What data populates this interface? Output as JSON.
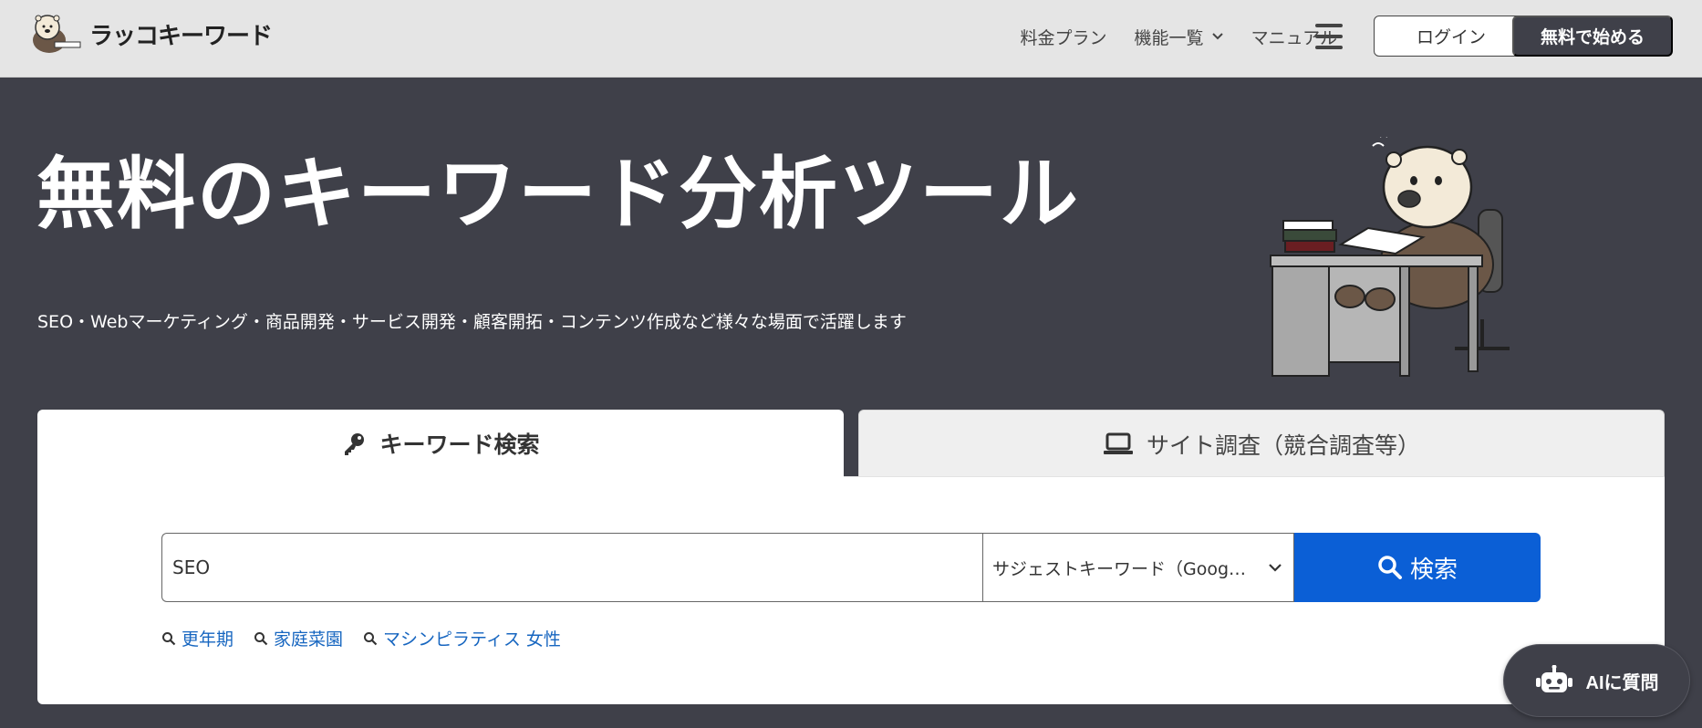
{
  "header": {
    "logo_text": "ラッコキーワード",
    "nav": [
      {
        "label": "料金プラン"
      },
      {
        "label": "機能一覧"
      },
      {
        "label": "マニュアル"
      }
    ],
    "login_label": "ログイン",
    "start_label": "無料で始める"
  },
  "hero": {
    "title": "無料のキーワード分析ツール",
    "subtitle": "SEO・Webマーケティング・商品開発・サービス開発・顧客開拓・コンテンツ作成など様々な場面で活躍します"
  },
  "tabs": [
    {
      "label": "キーワード検索",
      "icon": "key-icon",
      "active": true
    },
    {
      "label": "サイト調査（競合調査等）",
      "icon": "laptop-icon",
      "active": false
    }
  ],
  "search": {
    "value": "SEO",
    "mode": "サジェストキーワード（Google）",
    "button_label": "検索"
  },
  "suggestions": [
    {
      "label": "更年期"
    },
    {
      "label": "家庭菜園"
    },
    {
      "label": "マシンピラティス 女性"
    }
  ],
  "ai_button": {
    "label": "AIに質問"
  },
  "colors": {
    "background": "#3f4049",
    "header": "#e5e5e5",
    "accent": "#0b5fd6",
    "link": "#1766c0"
  }
}
